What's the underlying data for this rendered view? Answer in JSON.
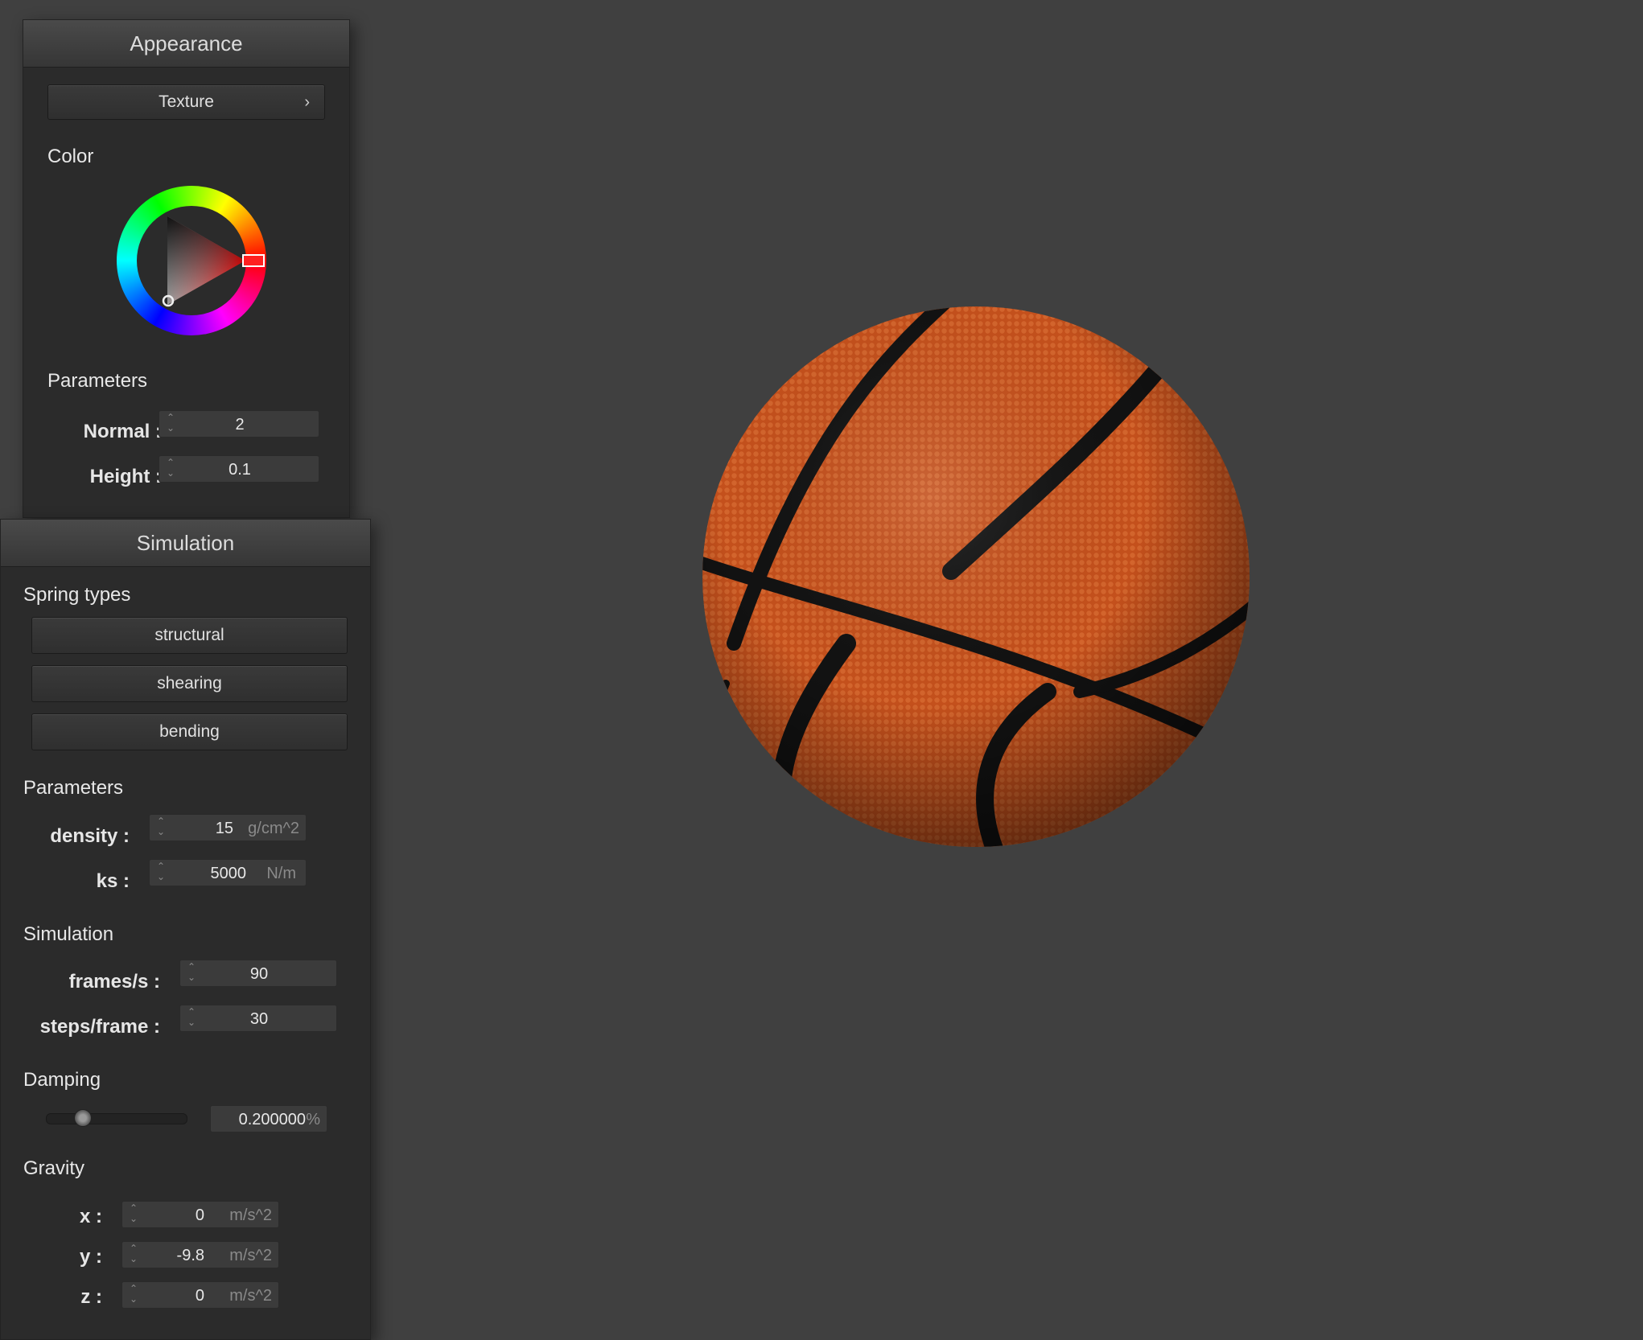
{
  "appearance": {
    "title": "Appearance",
    "texture_button": "Texture",
    "chevron": "›",
    "color_label": "Color",
    "parameters_label": "Parameters",
    "normal": {
      "label": "Normal :",
      "value": "2"
    },
    "height": {
      "label": "Height :",
      "value": "0.1"
    },
    "selected_color": "#ff0000"
  },
  "simulation_panel": {
    "title": "Simulation",
    "spring_types_label": "Spring types",
    "spring_buttons": [
      "structural",
      "shearing",
      "bending"
    ],
    "parameters_label": "Parameters",
    "density": {
      "label": "density :",
      "value": "15",
      "unit": "g/cm^2"
    },
    "ks": {
      "label": "ks :",
      "value": "5000",
      "unit": "N/m"
    },
    "simulation_label": "Simulation",
    "fps": {
      "label": "frames/s :",
      "value": "90"
    },
    "steps": {
      "label": "steps/frame :",
      "value": "30"
    },
    "damping_label": "Damping",
    "damping": {
      "value": "0.200000",
      "unit": "%",
      "slider_fraction": 0.2
    },
    "gravity_label": "Gravity",
    "gravity": [
      {
        "label": "x :",
        "value": "0",
        "unit": "m/s^2"
      },
      {
        "label": "y :",
        "value": "-9.8",
        "unit": "m/s^2"
      },
      {
        "label": "z :",
        "value": "0",
        "unit": "m/s^2"
      }
    ]
  },
  "icons": {
    "spinner": "spinner-arrows-icon",
    "chevron": "chevron-right-icon"
  },
  "colors": {
    "background": "#404040",
    "panel": "#2b2b2b",
    "ball": "#c8521c"
  }
}
